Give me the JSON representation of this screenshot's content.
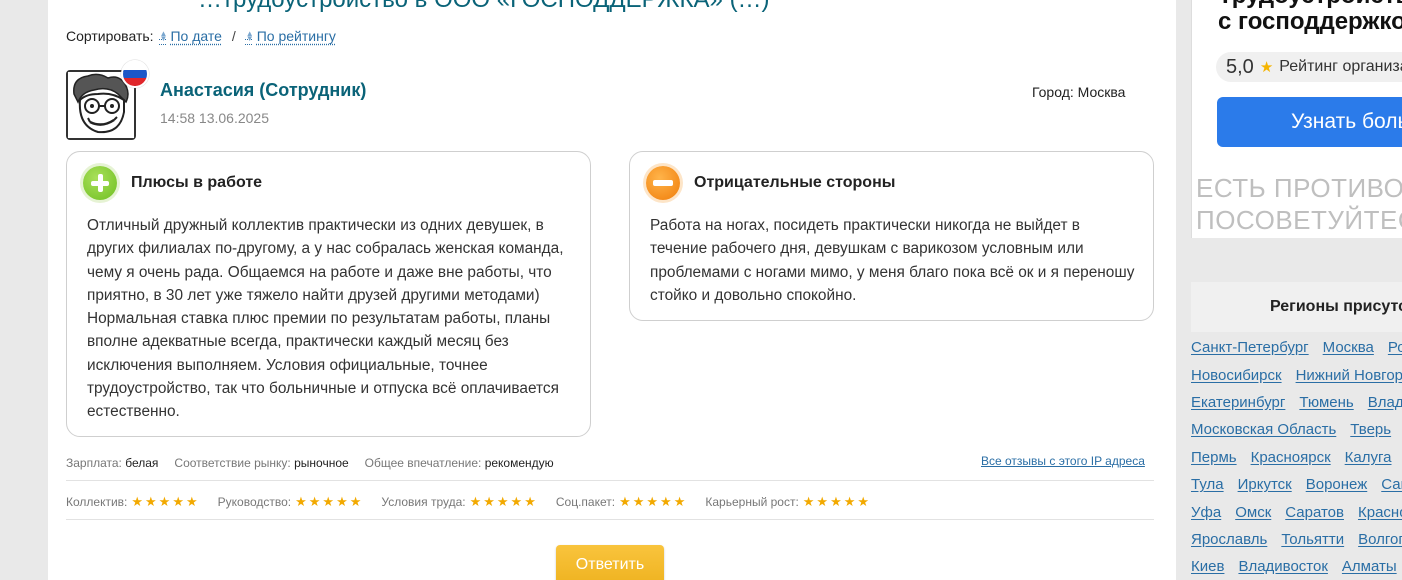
{
  "review": {
    "cut_title": "…трудоустройство в ООО «ГОСПОДДЕРЖКА» (…)",
    "sort": {
      "label": "Сортировать:",
      "by_date": "По дате",
      "sep": "/",
      "by_rating": "По рейтингу"
    },
    "author": "Анастасия (Сотрудник)",
    "datetime": "14:58 13.06.2025",
    "city": "Город: Москва",
    "pros": {
      "title": "Плюсы в работе",
      "text": "Отличный дружный коллектив практически из одних девушек, в других филиалах по-другому, а у нас собралась женская команда, чему я очень рада. Общаемся на работе и даже вне работы, что приятно, в 30 лет уже тяжело найти друзей другими методами) Нормальная ставка плюс премии по результатам работы, планы вполне адекватные всегда, практически каждый месяц без исключения выполняем. Условия официальные, точнее трудоустройство, так что больничные и отпуска всё оплачивается естественно."
    },
    "cons": {
      "title": "Отрицательные стороны",
      "text": "Работа на ногах, посидеть практически никогда не выйдет в течение рабочего дня, девушкам с варикозом условным или проблемами с ногами мимо, у меня благо пока всё ок и я переношу стойко и довольно спокойно."
    },
    "meta": {
      "salary_label": "Зарплата:",
      "salary_value": "белая",
      "market_label": "Соответствие рынку:",
      "market_value": "рыночное",
      "impression_label": "Общее впечатление:",
      "impression_value": "рекомендую",
      "ip_link": "Все отзывы с этого IP адреса"
    },
    "ratings": [
      {
        "label": "Коллектив:",
        "stars": 5
      },
      {
        "label": "Руководство:",
        "stars": 5
      },
      {
        "label": "Условия труда:",
        "stars": 5
      },
      {
        "label": "Соц.пакет:",
        "stars": 5
      },
      {
        "label": "Карьерный рост:",
        "stars": 5
      }
    ],
    "reply_button": "Ответить"
  },
  "sidebar": {
    "ad": {
      "title_top": "Трудоустройство",
      "title": "с господдержкой",
      "score": "5,0",
      "rating_text": "Рейтинг организации",
      "button": "Узнать больше",
      "watermark_1": "ЕСТЬ ПРОТИВОПОКАЗАНИЯ",
      "watermark_2": "ПОСОВЕТУЙТЕСЬ С ВРАЧОМ"
    },
    "regions_title": "Регионы присутствия",
    "regions": [
      [
        "Санкт-Петербург",
        "Москва",
        "Ростов-на-Дону"
      ],
      [
        "Новосибирск",
        "Нижний Новгород"
      ],
      [
        "Екатеринбург",
        "Тюмень",
        "Владимир"
      ],
      [
        "Московская Область",
        "Тверь"
      ],
      [
        "Пермь",
        "Красноярск",
        "Калуга"
      ],
      [
        "Тула",
        "Иркутск",
        "Воронеж",
        "Самара"
      ],
      [
        "Уфа",
        "Омск",
        "Саратов",
        "Краснодар"
      ],
      [
        "Ярославль",
        "Тольятти",
        "Волгоград"
      ],
      [
        "Киев",
        "Владивосток",
        "Алматы"
      ]
    ]
  },
  "colors": {
    "link": "#2a6ea5",
    "author": "#0a6378",
    "star": "#f2a900",
    "reply": "#f3b92a",
    "ad_button": "#2b7bea"
  }
}
